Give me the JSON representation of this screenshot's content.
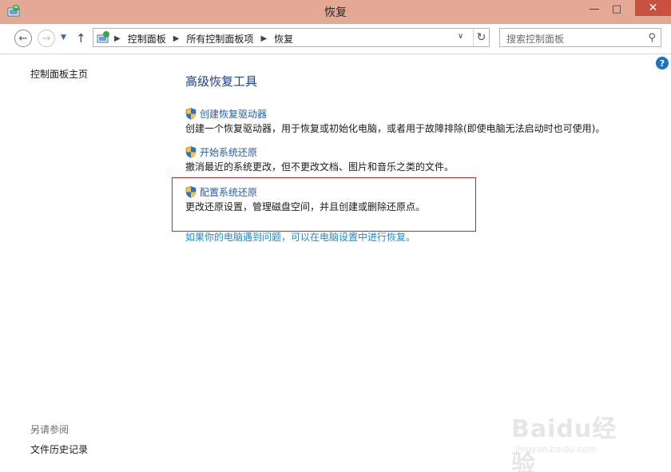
{
  "window": {
    "title": "恢复",
    "controls": {
      "minimize": "—",
      "maximize": "□",
      "close": "✕"
    }
  },
  "nav": {
    "back_icon": "arrow-left-icon",
    "forward_icon": "arrow-right-icon",
    "recent_icon": "chevron-down-icon",
    "up_icon": "arrow-up-icon",
    "breadcrumbs": [
      "控制面板",
      "所有控制面板项",
      "恢复"
    ],
    "refresh_icon": "refresh-icon",
    "search_placeholder": "搜索控制面板",
    "search_icon": "magnifier-icon"
  },
  "sidebar": {
    "home_link": "控制面板主页",
    "see_also_heading": "另请参阅",
    "see_also_items": [
      "文件历史记录"
    ]
  },
  "main": {
    "title": "高级恢复工具",
    "tools": [
      {
        "link": "创建恢复驱动器",
        "description": "创建一个恢复驱动器，用于恢复或初始化电脑，或者用于故障排除(即使电脑无法启动时也可使用)。",
        "icon": "uac-shield-icon"
      },
      {
        "link": "开始系统还原",
        "description": "撤消最近的系统更改，但不更改文档、图片和音乐之类的文件。",
        "icon": "uac-shield-icon"
      },
      {
        "link": "配置系统还原",
        "description": "更改还原设置，管理磁盘空间，并且创建或删除还原点。",
        "icon": "uac-shield-icon"
      }
    ],
    "pc_settings_link": "如果你的电脑遇到问题，可以在电脑设置中进行恢复。",
    "highlight_color": "#c1272d"
  },
  "watermark": {
    "brand": "Baidu经验",
    "url": "jingyan.baidu.com"
  },
  "colors": {
    "titlebar": "#e3a995",
    "close_button": "#c7503f",
    "link": "#1f5fb3",
    "heading": "#1f3d8a"
  }
}
